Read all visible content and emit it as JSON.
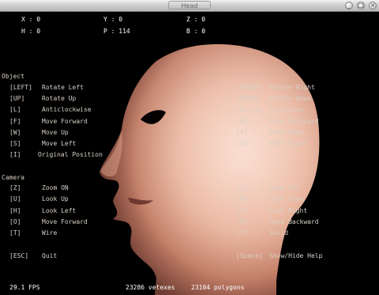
{
  "window": {
    "title": "Head",
    "button_labels": [
      "_",
      "□",
      "×"
    ]
  },
  "hud": {
    "x_label": "X : 0",
    "y_label": "Y : 0",
    "z_label": "Z : 0",
    "h_label": "H : 0",
    "p_label": "P : 114",
    "b_label": "B : 0"
  },
  "object": {
    "section_title": "Object",
    "rows": [
      {
        "left_key": "[LEFT]",
        "left_action": "Rotate Left",
        "right_key": "[RIGHT]",
        "right_action": "Rotate Right"
      },
      {
        "left_key": "[UP]",
        "left_action": "Rotate Up",
        "right_key": "[DOWN]",
        "right_action": "Rotate Down"
      },
      {
        "left_key": "[L]",
        "left_action": "Anticlockwise",
        "right_key": "[K],[R]",
        "right_action": "Clockwise"
      },
      {
        "left_key": "[F]",
        "left_action": "Move Forward",
        "right_key": "[B]",
        "right_action": "Move Backward"
      },
      {
        "left_key": "[W]",
        "left_action": "Move Up",
        "right_key": "[X]",
        "right_action": "Move Down"
      },
      {
        "left_key": "[S]",
        "left_action": "Move Left",
        "right_key": "[D]",
        "right_action": "Move Right"
      },
      {
        "left_key": "[I]",
        "left_action": "Original Position",
        "right_key": "",
        "right_action": ""
      }
    ]
  },
  "camera": {
    "section_title": "Camera",
    "rows": [
      {
        "left_key": "[Z]",
        "left_action": "Zoom ON",
        "right_key": "[Q]",
        "right_action": "Zoom Off"
      },
      {
        "left_key": "[U]",
        "left_action": "Look Up",
        "right_key": "[N]",
        "right_action": "Look Down"
      },
      {
        "left_key": "[H]",
        "left_action": "Look Left",
        "right_key": "[J]",
        "right_action": "Look Right"
      },
      {
        "left_key": "[O]",
        "left_action": "Move Forward",
        "right_key": "[P]",
        "right_action": "Move Backward"
      },
      {
        "left_key": "[T]",
        "left_action": "Wire",
        "right_key": "[Y]",
        "right_action": "Solid"
      }
    ]
  },
  "misc": {
    "esc_key": "[ESC]",
    "esc_action": "Quit",
    "space_key": "[Space]",
    "space_action": "Show/Hide Help"
  },
  "status": {
    "fps": "29.1 FPS",
    "vertexes": "23286 vetexes",
    "polygons": "23104 polygons"
  }
}
